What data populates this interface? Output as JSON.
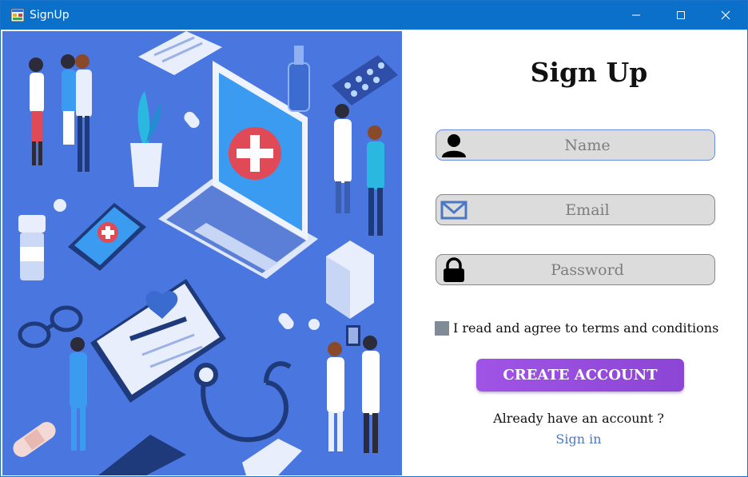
{
  "window": {
    "title": "SignUp",
    "controls": {
      "minimize": "minimize",
      "maximize": "maximize",
      "close": "close"
    }
  },
  "illustration": {
    "icons": [
      "laptop-medical-cross-icon",
      "phone-medical-cross-icon",
      "clipboard-heart-icon",
      "stethoscope-icon",
      "pills-blister-icon",
      "pill-bottle-icon",
      "eyeglasses-icon",
      "bandage-icon",
      "doctor-figures-icon"
    ],
    "colors": {
      "background": "#4a76e0",
      "accent_red": "#e04a57",
      "light": "#e8f0ff"
    }
  },
  "form": {
    "heading": "Sign Up",
    "name": {
      "placeholder": "Name",
      "value": "",
      "icon": "user-icon"
    },
    "email": {
      "placeholder": "Email",
      "value": "",
      "icon": "envelope-icon"
    },
    "password": {
      "placeholder": "Password",
      "value": "",
      "icon": "lock-icon"
    },
    "agree": {
      "label": "I read and agree to terms and conditions",
      "checked": false
    },
    "create_button": "CREATE ACCOUNT",
    "already_text": "Already have an account ?",
    "signin_link": "Sign in"
  },
  "colors": {
    "titlebar": "#0b70c9",
    "button_gradient_start": "#a054e6",
    "button_gradient_end": "#8c45d4",
    "link": "#4a78c4",
    "field_bg": "#dcdcdc"
  }
}
